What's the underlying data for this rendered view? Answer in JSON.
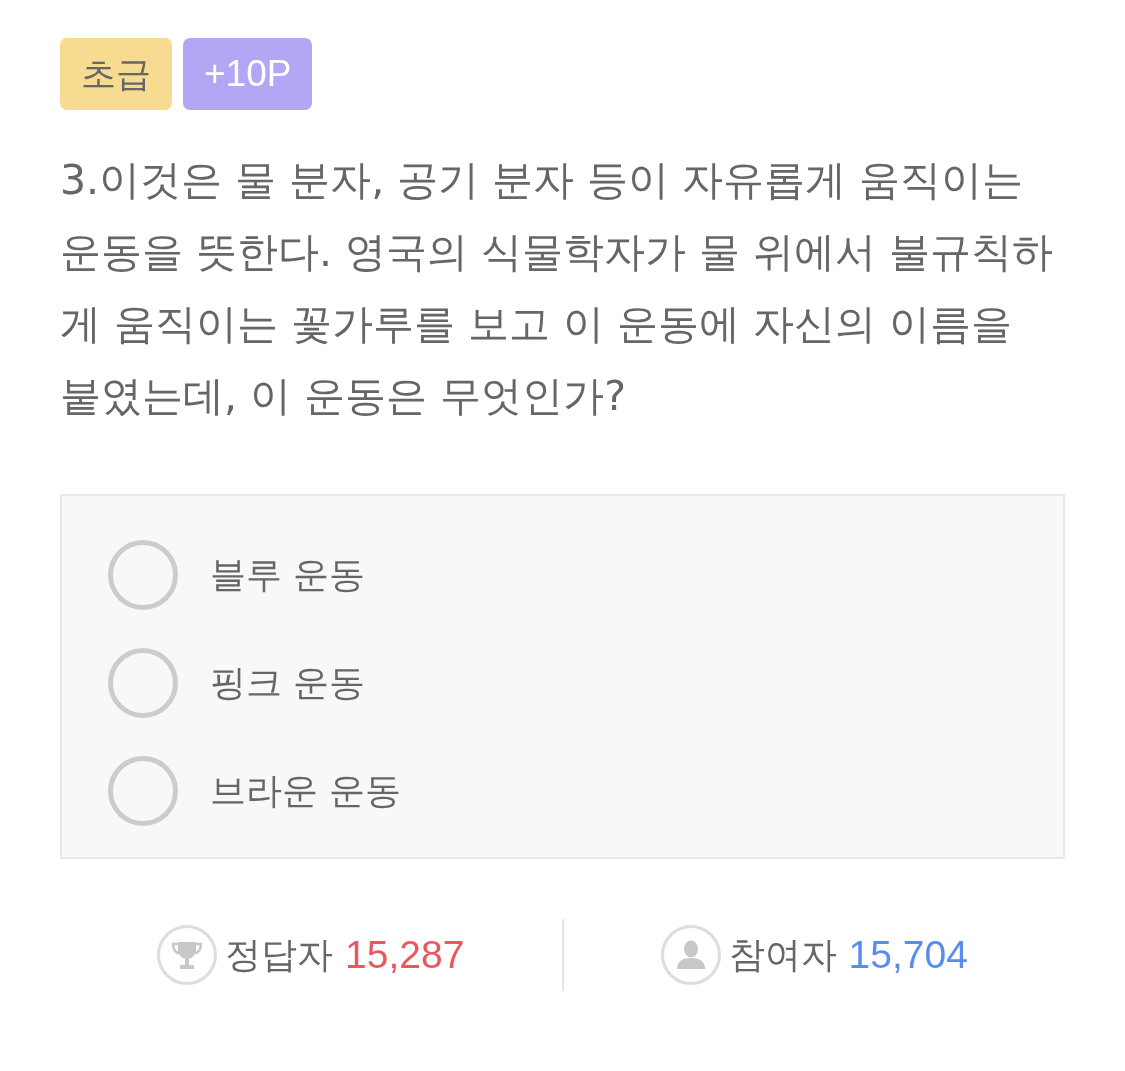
{
  "badges": [
    {
      "kind": "level",
      "label": "초급"
    },
    {
      "kind": "points",
      "label": "+10P"
    }
  ],
  "question": "3.이것은 물 분자, 공기 분자 등이 자유롭게 움직이는 운동을 뜻한다. 영국의 식물학자가 물 위에서 불규칙하게 움직이는 꽃가루를 보고 이 운동에 자신의 이름을 붙였는데, 이 운동은 무엇인가?",
  "options": [
    {
      "label": "블루 운동",
      "selected": false
    },
    {
      "label": "핑크 운동",
      "selected": false
    },
    {
      "label": "브라운 운동",
      "selected": false
    }
  ],
  "stats": [
    {
      "kind": "correct",
      "label": "정답자",
      "count": "15,287",
      "color": "#e8595f"
    },
    {
      "kind": "participants",
      "label": "참여자",
      "count": "15,704",
      "color": "#5a8cf0"
    }
  ]
}
